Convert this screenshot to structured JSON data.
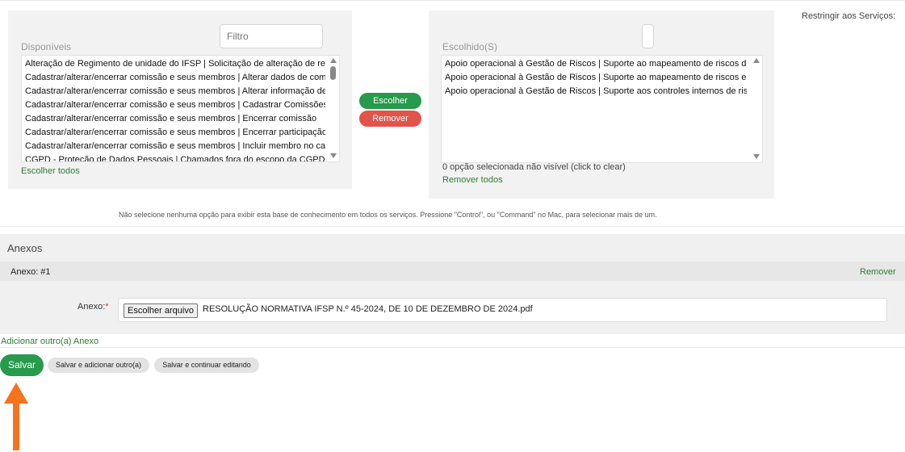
{
  "selector": {
    "available": {
      "title": "Disponíveis",
      "filter_placeholder": "Filtro",
      "options": [
        "Alteração de Regimento de unidade do IFSP | Solicitação de alteração de regimento",
        "Cadastrar/alterar/encerrar comissão e seus membros | Alterar dados de comissão",
        "Cadastrar/alterar/encerrar comissão e seus membros | Alterar informação de membro",
        "Cadastrar/alterar/encerrar comissão e seus membros | Cadastrar Comissões",
        "Cadastrar/alterar/encerrar comissão e seus membros | Encerrar comissão",
        "Cadastrar/alterar/encerrar comissão e seus membros | Encerrar participação de membro",
        "Cadastrar/alterar/encerrar comissão e seus membros | Incluir membro no cadastro",
        "CGPD - Proteção de Dados Pessoais | Chamados fora do escopo da CGPD"
      ],
      "choose_all_label": "Escolher todos"
    },
    "choose_button": "Escolher",
    "remove_button": "Remover",
    "chosen": {
      "title": "Escolhido(S)",
      "filter_value": "",
      "options": [
        "Apoio operacional à Gestão de Riscos | Suporte ao mapeamento de riscos das atividades",
        "Apoio operacional à Gestão de Riscos | Suporte ao mapeamento de riscos estratégicos",
        "Apoio operacional à Gestão de Riscos | Suporte aos controles internos de riscos"
      ],
      "status": "0 opção selecionada não visível (click to clear)",
      "remove_all_label": "Remover todos"
    },
    "restrict_label": "Restringir aos Serviços:",
    "help_text": "Não selecione nenhuma opção para exibir esta base de conhecimento em todos os serviços. Pressione \"Control\", ou \"Command\" no Mac, para selecionar mais de um."
  },
  "attachments": {
    "title": "Anexos",
    "item_label": "Anexo: #1",
    "remove_label": "Remover",
    "field_label": "Anexo:",
    "required_mark": "*",
    "file_button": "Escolher arquivo",
    "file_name": "RESOLUÇÃO NORMATIVA IFSP N.º 45-2024, DE 10 DE DEZEMBRO DE 2024.pdf",
    "add_another": "Adicionar outro(a) Anexo"
  },
  "actions": {
    "save": "Salvar",
    "save_add": "Salvar e adicionar outro(a)",
    "save_continue": "Salvar e continuar editando"
  },
  "colors": {
    "primary_green": "#279a4b",
    "danger_red": "#e2534a",
    "link_green": "#2e7d32",
    "annotation_orange": "#f5731f"
  }
}
